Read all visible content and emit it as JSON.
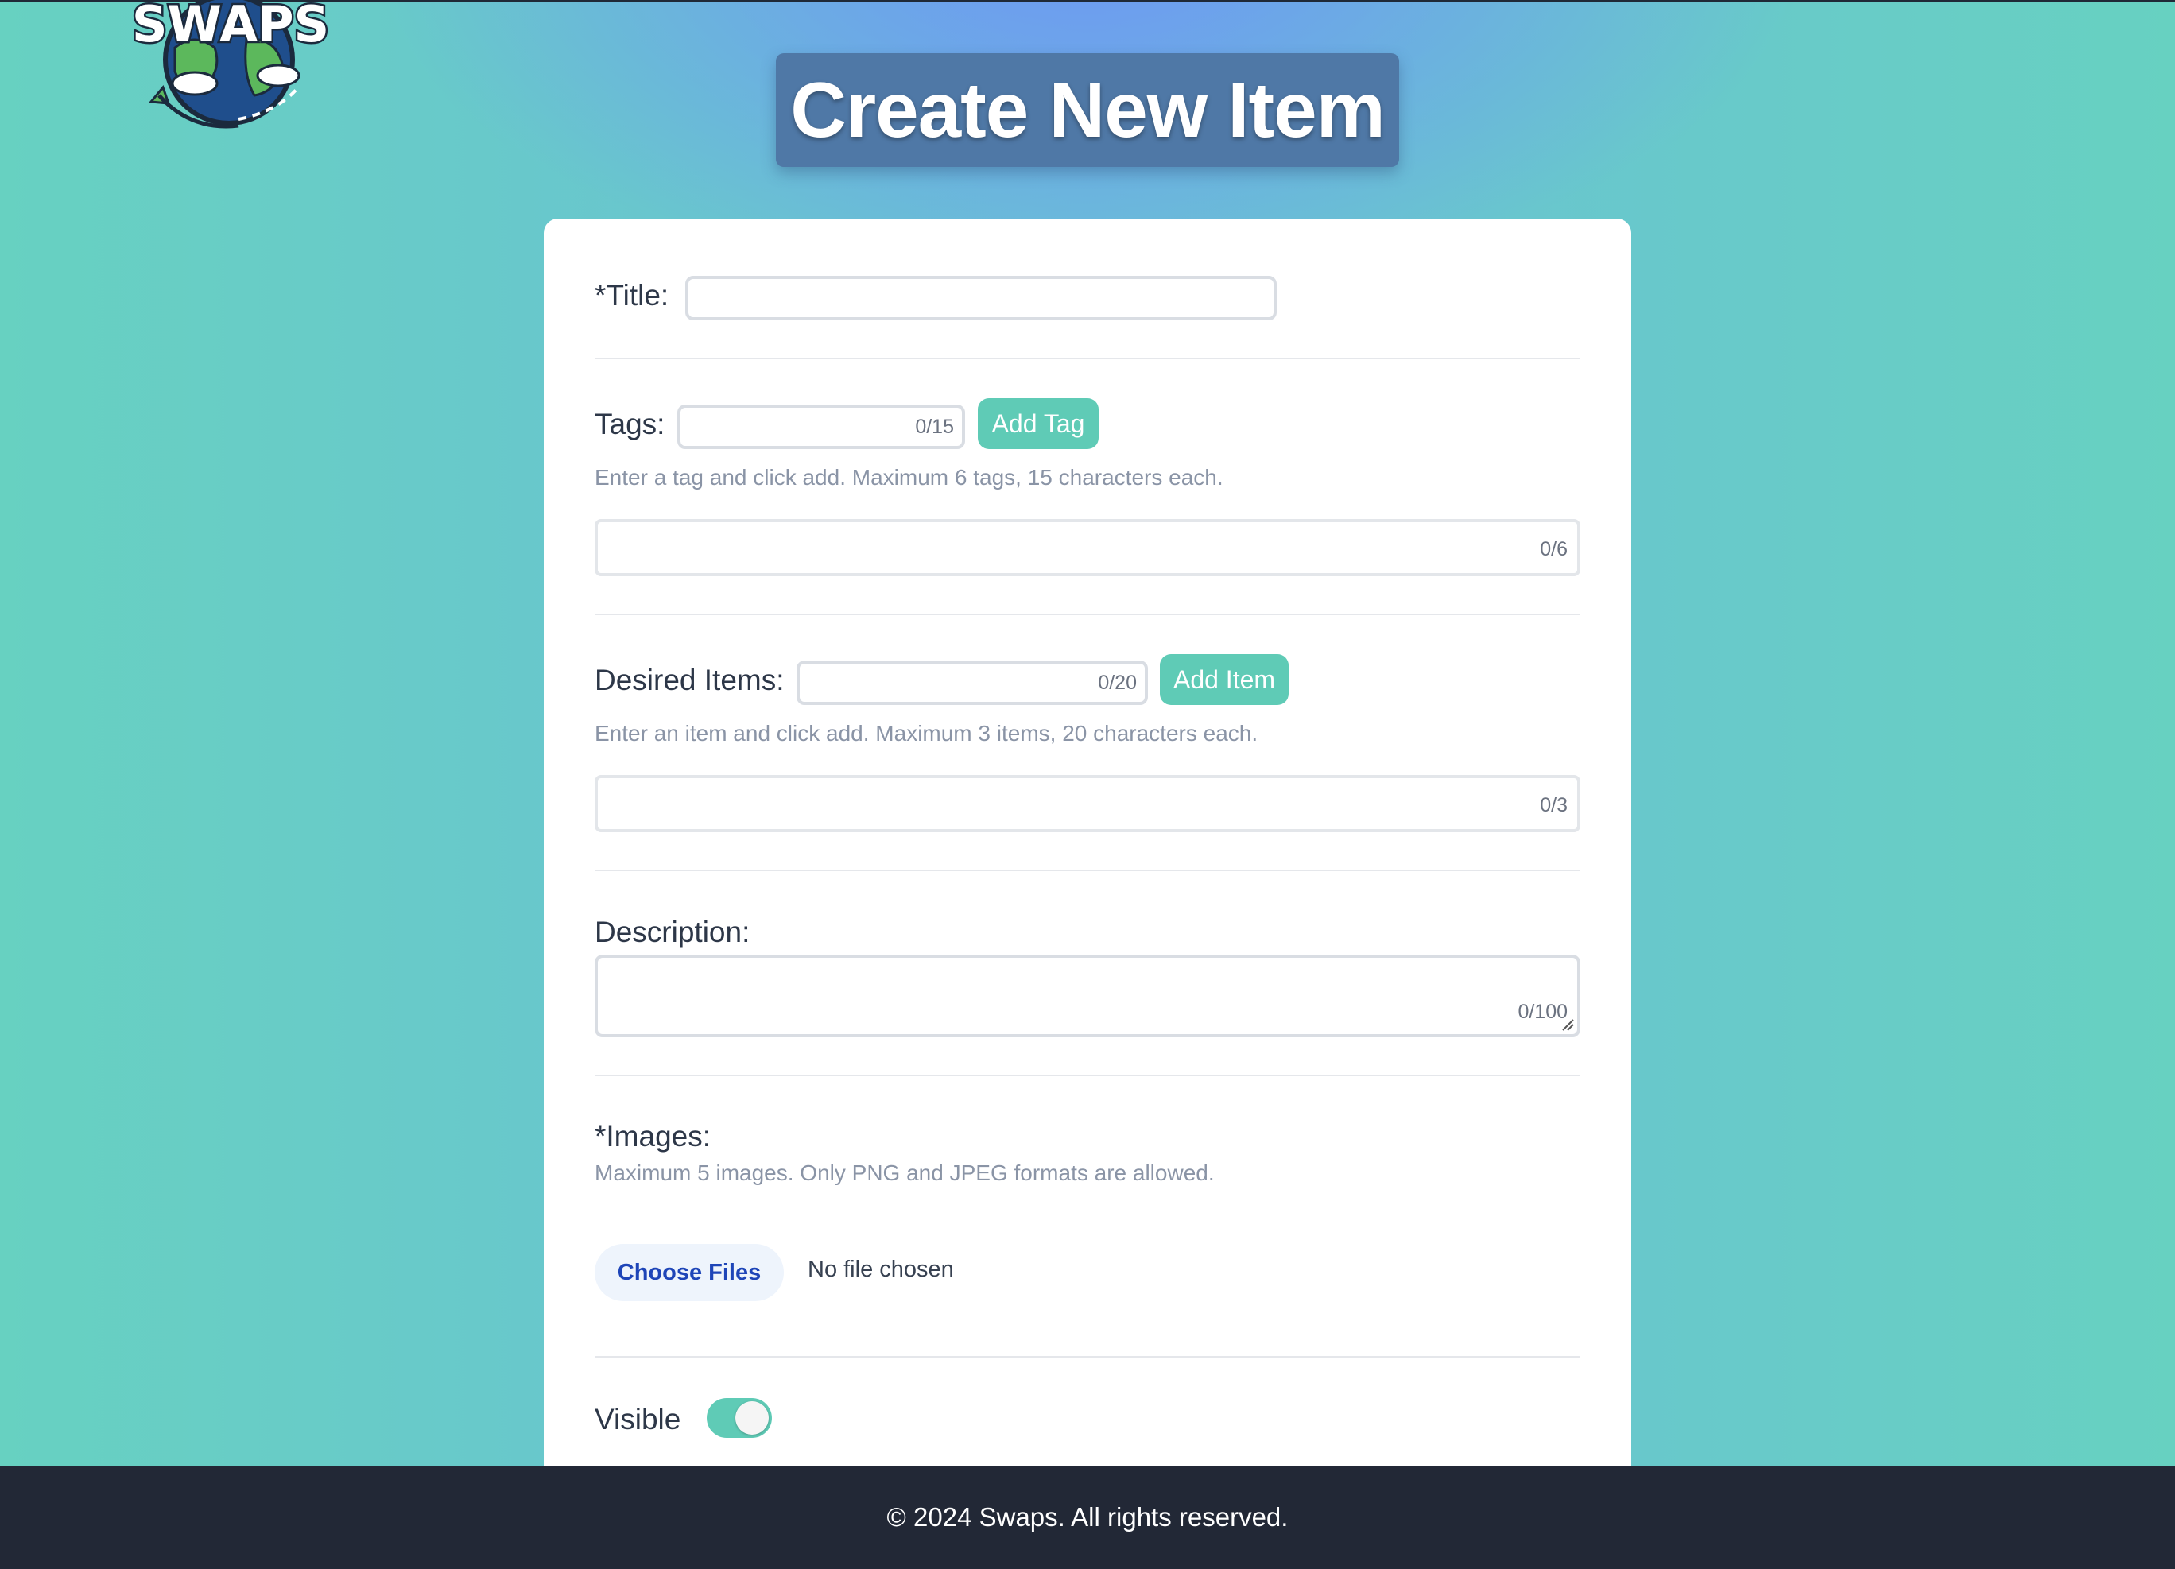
{
  "header": {
    "logo_text": "SWAPS",
    "title": "Create New Item"
  },
  "form": {
    "title_label": "*Title:",
    "title_value": "",
    "tags": {
      "label": "Tags:",
      "counter": "0/15",
      "button": "Add Tag",
      "hint": "Enter a tag and click add. Maximum 6 tags, 15 characters each.",
      "list_counter": "0/6"
    },
    "desired_items": {
      "label": "Desired Items:",
      "counter": "0/20",
      "button": "Add Item",
      "hint": "Enter an item and click add. Maximum 3 items, 20 characters each.",
      "list_counter": "0/3"
    },
    "description": {
      "label": "Description:",
      "counter": "0/100"
    },
    "images": {
      "label": "*Images:",
      "hint": "Maximum 5 images. Only PNG and JPEG formats are allowed.",
      "choose_button": "Choose Files",
      "file_status": "No file chosen"
    },
    "visible": {
      "label": "Visible",
      "on": true
    }
  },
  "footer": {
    "text": "© 2024 Swaps. All rights reserved."
  },
  "colors": {
    "accent": "#5fcbb6",
    "title_bg": "#4f78a6",
    "footer_bg": "#222836",
    "choose_files_text": "#1e45b8"
  }
}
